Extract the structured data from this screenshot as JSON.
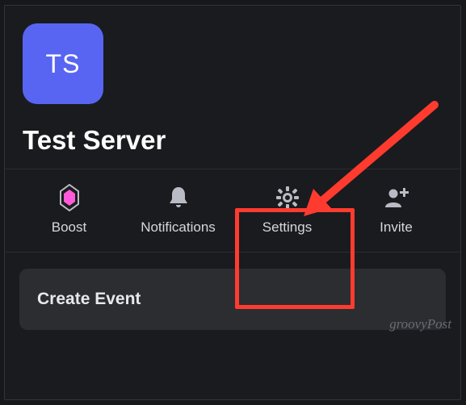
{
  "server": {
    "initials": "TS",
    "name": "Test Server"
  },
  "actions": {
    "boost": {
      "label": "Boost",
      "icon": "boost-gem-icon"
    },
    "notifications": {
      "label": "Notifications",
      "icon": "bell-icon"
    },
    "settings": {
      "label": "Settings",
      "icon": "gear-icon"
    },
    "invite": {
      "label": "Invite",
      "icon": "invite-user-icon"
    }
  },
  "event_card": {
    "title": "Create Event"
  },
  "annotation": {
    "watermark": "groovyPost"
  },
  "colors": {
    "accent": "#5865f2",
    "highlight": "#ff3b2f",
    "boost_gem": "#ff5bd8"
  }
}
